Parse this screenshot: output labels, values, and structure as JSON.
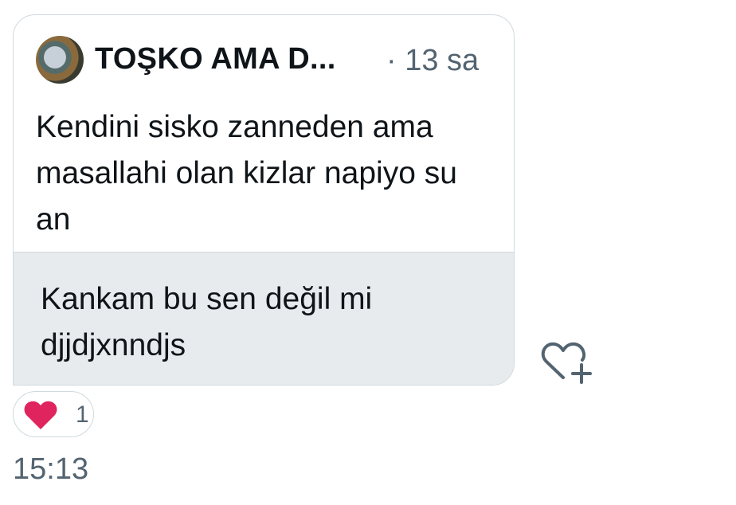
{
  "message": {
    "quoted_tweet": {
      "author": "TOŞKO AMA D...",
      "time": "· 13 sa",
      "text": "Kendini sisko zanneden ama masallahi olan kizlar napiyo su an"
    },
    "reply_text": "Kankam bu sen değil mi djjdjxnndjs",
    "reaction": {
      "emoji_icon": "heart-icon",
      "count": "1",
      "color": "#e0245e"
    },
    "react_button_icon": "heart-plus-icon",
    "timestamp": "15:13"
  },
  "colors": {
    "border": "#cfd9de",
    "reply_bg": "#e7ebee",
    "secondary_text": "#536471",
    "primary_text": "#0f1419"
  }
}
